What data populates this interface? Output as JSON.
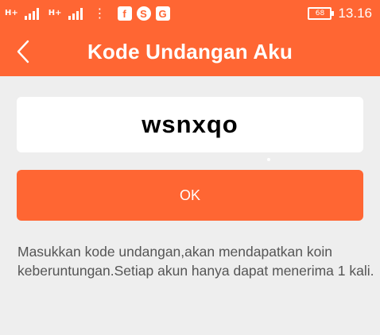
{
  "status_bar": {
    "sim1_label": "H+",
    "sim2_label": "H+",
    "app_icons": [
      "facebook-icon",
      "browser-s-icon",
      "g-icon"
    ],
    "battery": "68",
    "time": "13.16"
  },
  "app_bar": {
    "title": "Kode Undangan Aku"
  },
  "invite": {
    "code": "wsnxqo"
  },
  "actions": {
    "ok_label": "OK"
  },
  "info": {
    "text": "Masukkan kode undangan,akan mendapatkan koin keberuntungan.Setiap akun hanya dapat menerima 1 kali."
  },
  "colors": {
    "accent": "#ff6633",
    "background": "#eeeeee",
    "card": "#ffffff",
    "body_text": "#555555"
  }
}
